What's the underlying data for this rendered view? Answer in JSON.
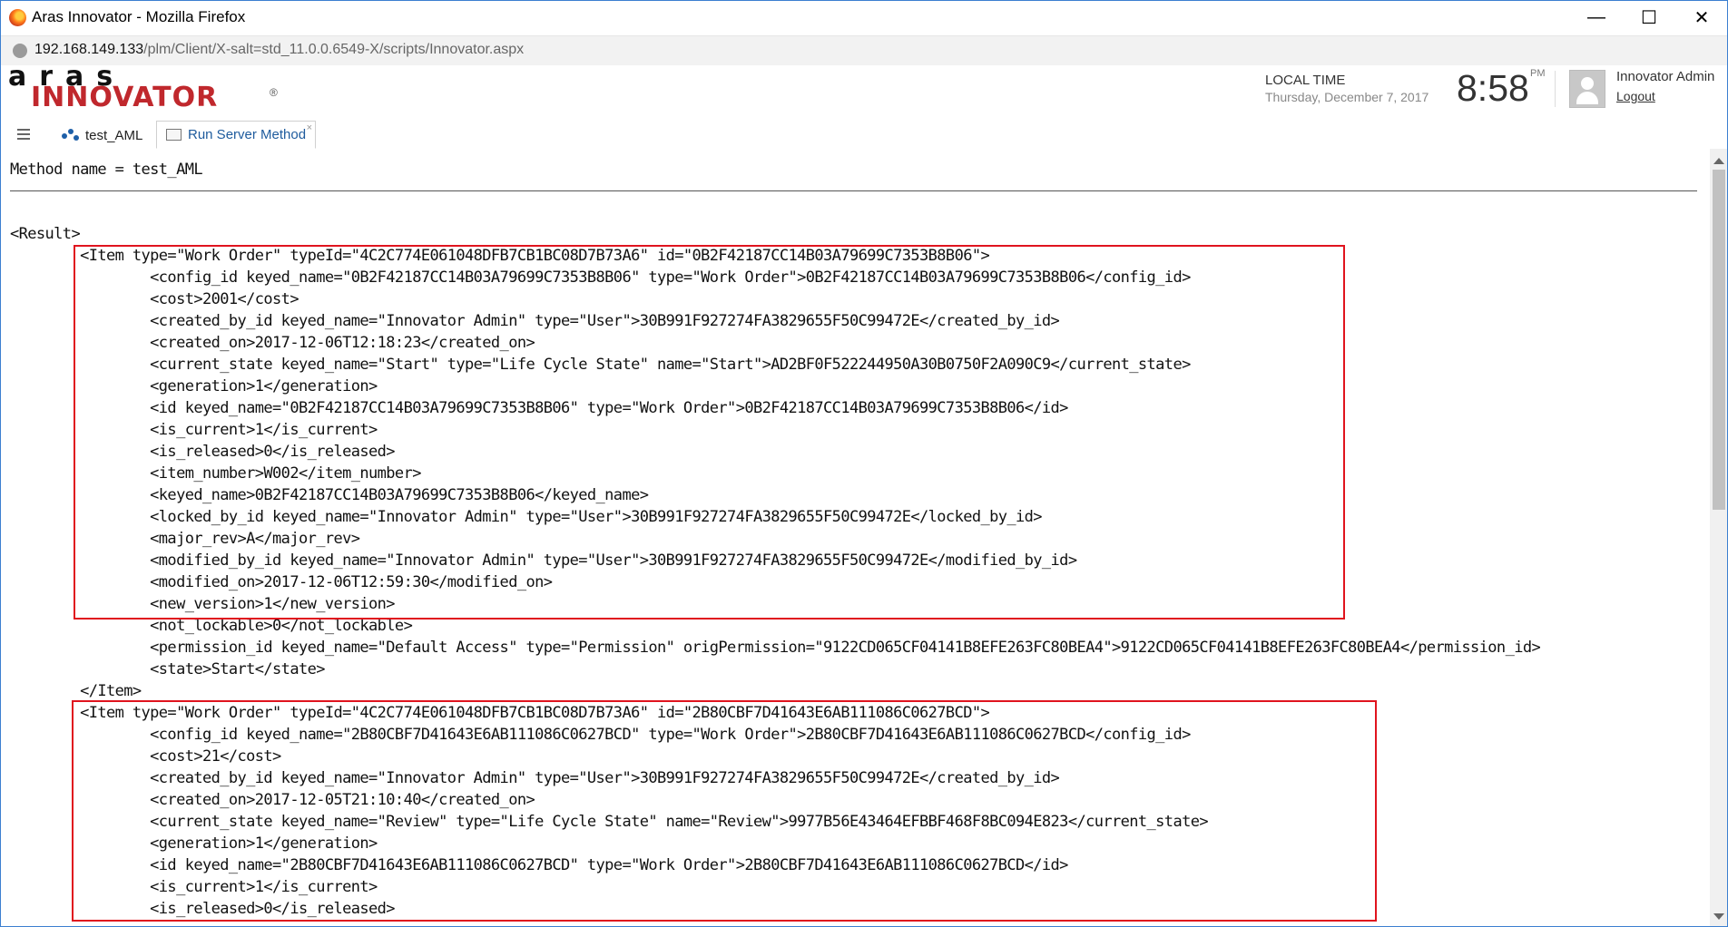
{
  "window": {
    "title": "Aras Innovator - Mozilla Firefox",
    "minimize": "—",
    "maximize": "☐",
    "close": "✕"
  },
  "address": {
    "host": "192.168.149.133",
    "path": "/plm/Client/X-salt=std_11.0.0.6549-X/scripts/Innovator.aspx"
  },
  "brand": {
    "line1": "aras",
    "line2": "INNOVATOR",
    "reg": "®"
  },
  "header": {
    "local_time_label": "LOCAL TIME",
    "date": "Thursday, December 7, 2017",
    "time": "8:58",
    "ampm": "PM",
    "user_name": "Innovator Admin",
    "logout": "Logout"
  },
  "tabs": [
    {
      "label": "test_AML"
    },
    {
      "label": "Run Server Method",
      "close": "×"
    }
  ],
  "output": {
    "method_line": "Method name = test_AML",
    "lines": [
      "<Result>",
      "        <Item type=\"Work Order\" typeId=\"4C2C774E061048DFB7CB1BC08D7B73A6\" id=\"0B2F42187CC14B03A79699C7353B8B06\">",
      "                <config_id keyed_name=\"0B2F42187CC14B03A79699C7353B8B06\" type=\"Work Order\">0B2F42187CC14B03A79699C7353B8B06</config_id>",
      "                <cost>2001</cost>",
      "                <created_by_id keyed_name=\"Innovator Admin\" type=\"User\">30B991F927274FA3829655F50C99472E</created_by_id>",
      "                <created_on>2017-12-06T12:18:23</created_on>",
      "                <current_state keyed_name=\"Start\" type=\"Life Cycle State\" name=\"Start\">AD2BF0F522244950A30B0750F2A090C9</current_state>",
      "                <generation>1</generation>",
      "                <id keyed_name=\"0B2F42187CC14B03A79699C7353B8B06\" type=\"Work Order\">0B2F42187CC14B03A79699C7353B8B06</id>",
      "                <is_current>1</is_current>",
      "                <is_released>0</is_released>",
      "                <item_number>W002</item_number>",
      "                <keyed_name>0B2F42187CC14B03A79699C7353B8B06</keyed_name>",
      "                <locked_by_id keyed_name=\"Innovator Admin\" type=\"User\">30B991F927274FA3829655F50C99472E</locked_by_id>",
      "                <major_rev>A</major_rev>",
      "                <modified_by_id keyed_name=\"Innovator Admin\" type=\"User\">30B991F927274FA3829655F50C99472E</modified_by_id>",
      "                <modified_on>2017-12-06T12:59:30</modified_on>",
      "                <new_version>1</new_version>",
      "                <not_lockable>0</not_lockable>",
      "                <permission_id keyed_name=\"Default Access\" type=\"Permission\" origPermission=\"9122CD065CF04141B8EFE263FC80BEA4\">9122CD065CF04141B8EFE263FC80BEA4</permission_id>",
      "                <state>Start</state>",
      "        </Item>",
      "        <Item type=\"Work Order\" typeId=\"4C2C774E061048DFB7CB1BC08D7B73A6\" id=\"2B80CBF7D41643E6AB111086C0627BCD\">",
      "                <config_id keyed_name=\"2B80CBF7D41643E6AB111086C0627BCD\" type=\"Work Order\">2B80CBF7D41643E6AB111086C0627BCD</config_id>",
      "                <cost>21</cost>",
      "                <created_by_id keyed_name=\"Innovator Admin\" type=\"User\">30B991F927274FA3829655F50C99472E</created_by_id>",
      "                <created_on>2017-12-05T21:10:40</created_on>",
      "                <current_state keyed_name=\"Review\" type=\"Life Cycle State\" name=\"Review\">9977B56E43464EFBBF468F8BC094E823</current_state>",
      "                <generation>1</generation>",
      "                <id keyed_name=\"2B80CBF7D41643E6AB111086C0627BCD\" type=\"Work Order\">2B80CBF7D41643E6AB111086C0627BCD</id>",
      "                <is_current>1</is_current>",
      "                <is_released>0</is_released>"
    ]
  },
  "highlight_color": "#e0141e"
}
